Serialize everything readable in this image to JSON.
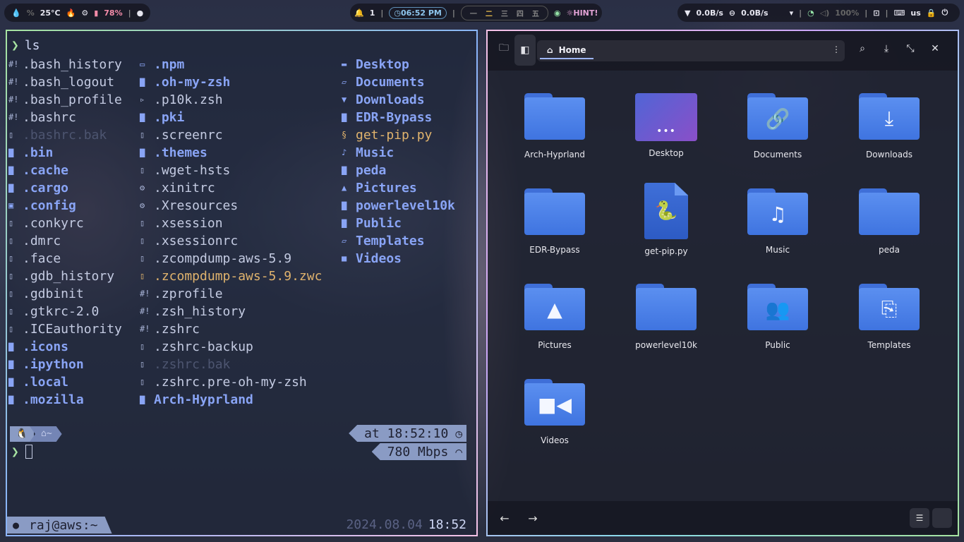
{
  "topbar": {
    "left": {
      "temperature": "25°C",
      "battery": "78%"
    },
    "middle": {
      "notifications": "1",
      "clock": "06:52 PM",
      "workspaces": [
        "一",
        "二",
        "三",
        "四",
        "五"
      ],
      "hint": "HINT!"
    },
    "right": {
      "net_down": "0.0B/s",
      "net_up": "0.0B/s",
      "volume": "100%",
      "keyboard_layout": "us"
    }
  },
  "terminal": {
    "command": "ls",
    "columns": [
      [
        {
          "name": ".bash_history",
          "kind": "file",
          "icon": "hash-bang-icon"
        },
        {
          "name": ".bash_logout",
          "kind": "file",
          "icon": "hash-bang-icon"
        },
        {
          "name": ".bash_profile",
          "kind": "file",
          "icon": "hash-bang-icon"
        },
        {
          "name": ".bashrc",
          "kind": "file",
          "icon": "hash-bang-icon"
        },
        {
          "name": ".bashrc.bak",
          "kind": "dim",
          "icon": "file-icon"
        },
        {
          "name": ".bin",
          "kind": "dir",
          "icon": "folder-icon"
        },
        {
          "name": ".cache",
          "kind": "dir",
          "icon": "folder-icon"
        },
        {
          "name": ".cargo",
          "kind": "dir",
          "icon": "folder-icon"
        },
        {
          "name": ".config",
          "kind": "dir",
          "icon": "folder-gear-icon"
        },
        {
          "name": ".conkyrc",
          "kind": "file",
          "icon": "file-icon"
        },
        {
          "name": ".dmrc",
          "kind": "file",
          "icon": "file-icon"
        },
        {
          "name": ".face",
          "kind": "file",
          "icon": "file-icon"
        },
        {
          "name": ".gdb_history",
          "kind": "file",
          "icon": "file-icon"
        },
        {
          "name": ".gdbinit",
          "kind": "file",
          "icon": "file-icon"
        },
        {
          "name": ".gtkrc-2.0",
          "kind": "file",
          "icon": "file-icon"
        },
        {
          "name": ".ICEauthority",
          "kind": "file",
          "icon": "file-icon"
        },
        {
          "name": ".icons",
          "kind": "dir",
          "icon": "folder-icon"
        },
        {
          "name": ".ipython",
          "kind": "dir",
          "icon": "folder-icon"
        },
        {
          "name": ".local",
          "kind": "dir",
          "icon": "folder-icon"
        },
        {
          "name": ".mozilla",
          "kind": "dir",
          "icon": "folder-icon"
        }
      ],
      [
        {
          "name": ".npm",
          "kind": "dir",
          "icon": "npm-icon"
        },
        {
          "name": ".oh-my-zsh",
          "kind": "dir",
          "icon": "folder-icon"
        },
        {
          "name": ".p10k.zsh",
          "kind": "file",
          "icon": "terminal-icon"
        },
        {
          "name": ".pki",
          "kind": "dir",
          "icon": "folder-icon"
        },
        {
          "name": ".screenrc",
          "kind": "file",
          "icon": "file-icon"
        },
        {
          "name": ".themes",
          "kind": "dir",
          "icon": "folder-icon"
        },
        {
          "name": ".wget-hsts",
          "kind": "file",
          "icon": "file-icon"
        },
        {
          "name": ".xinitrc",
          "kind": "file",
          "icon": "gear-icon"
        },
        {
          "name": ".Xresources",
          "kind": "file",
          "icon": "gear-icon"
        },
        {
          "name": ".xsession",
          "kind": "file",
          "icon": "file-icon"
        },
        {
          "name": ".xsessionrc",
          "kind": "file",
          "icon": "file-icon"
        },
        {
          "name": ".zcompdump-aws-5.9",
          "kind": "file",
          "icon": "file-icon"
        },
        {
          "name": ".zcompdump-aws-5.9.zwc",
          "kind": "gold",
          "icon": "file-icon"
        },
        {
          "name": ".zprofile",
          "kind": "file",
          "icon": "hash-bang-icon"
        },
        {
          "name": ".zsh_history",
          "kind": "file",
          "icon": "hash-bang-icon"
        },
        {
          "name": ".zshrc",
          "kind": "file",
          "icon": "hash-bang-icon"
        },
        {
          "name": ".zshrc-backup",
          "kind": "file",
          "icon": "file-icon"
        },
        {
          "name": ".zshrc.bak",
          "kind": "dim",
          "icon": "file-icon"
        },
        {
          "name": ".zshrc.pre-oh-my-zsh",
          "kind": "file",
          "icon": "file-icon"
        },
        {
          "name": "Arch-Hyprland",
          "kind": "dir",
          "icon": "folder-icon"
        }
      ],
      [
        {
          "name": "Desktop",
          "kind": "dir",
          "icon": "desktop-icon"
        },
        {
          "name": "Documents",
          "kind": "dir",
          "icon": "folder-open-icon"
        },
        {
          "name": "Downloads",
          "kind": "dir",
          "icon": "folder-download-icon"
        },
        {
          "name": "EDR-Bypass",
          "kind": "dir",
          "icon": "folder-icon"
        },
        {
          "name": "get-pip.py",
          "kind": "gold",
          "icon": "python-icon"
        },
        {
          "name": "Music",
          "kind": "dir",
          "icon": "folder-music-icon"
        },
        {
          "name": "peda",
          "kind": "dir",
          "icon": "folder-icon"
        },
        {
          "name": "Pictures",
          "kind": "dir",
          "icon": "folder-image-icon"
        },
        {
          "name": "powerlevel10k",
          "kind": "dir",
          "icon": "folder-icon"
        },
        {
          "name": "Public",
          "kind": "dir",
          "icon": "folder-icon"
        },
        {
          "name": "Templates",
          "kind": "dir",
          "icon": "folder-open-icon"
        },
        {
          "name": "Videos",
          "kind": "dir",
          "icon": "folder-video-icon"
        }
      ]
    ],
    "prompt_home": "~",
    "right_prompt": {
      "time": "at 18:52:10",
      "net": "780 Mbps"
    },
    "statusline": {
      "user_host": "raj@aws:~",
      "date": "2024.08.04",
      "time": "18:52"
    }
  },
  "file_manager": {
    "breadcrumb": "Home",
    "items": [
      {
        "name": "Arch-Hyprland",
        "type": "folder",
        "glyph": ""
      },
      {
        "name": "Desktop",
        "type": "desktop",
        "glyph": "•••"
      },
      {
        "name": "Documents",
        "type": "folder",
        "glyph": "🔗"
      },
      {
        "name": "Downloads",
        "type": "folder",
        "glyph": "⤓"
      },
      {
        "name": "EDR-Bypass",
        "type": "folder",
        "glyph": ""
      },
      {
        "name": "get-pip.py",
        "type": "python",
        "glyph": "🐍"
      },
      {
        "name": "Music",
        "type": "folder",
        "glyph": "♫"
      },
      {
        "name": "peda",
        "type": "folder",
        "glyph": ""
      },
      {
        "name": "Pictures",
        "type": "folder",
        "glyph": "▲"
      },
      {
        "name": "powerlevel10k",
        "type": "folder",
        "glyph": ""
      },
      {
        "name": "Public",
        "type": "folder",
        "glyph": "👥"
      },
      {
        "name": "Templates",
        "type": "folder",
        "glyph": "⎘"
      },
      {
        "name": "Videos",
        "type": "folder",
        "glyph": "■◀"
      }
    ]
  }
}
